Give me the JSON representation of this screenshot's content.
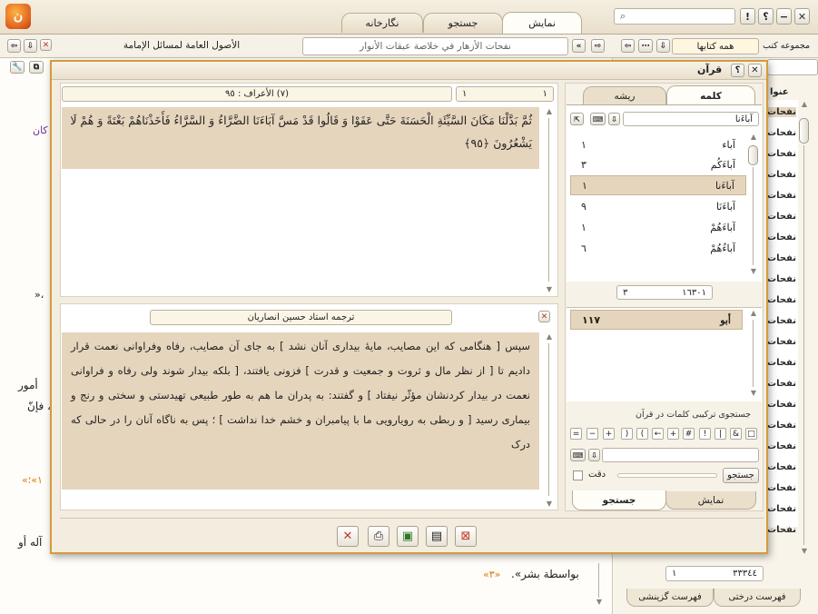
{
  "app": {
    "logo": "logo-icon",
    "top_tabs": [
      "نمایش",
      "جستجو",
      "نگارخانه"
    ],
    "search_value": "",
    "window_controls": [
      "close-icon",
      "minimize-icon",
      "help-icon",
      "info-icon"
    ]
  },
  "toolbar": {
    "book_title_left": "الأصول العامة لمسائل الإمامة",
    "book_title_mid": "نفحات الأزهار في خلاصة عبقات الأنوار",
    "collection_label": "مجموعه کتب",
    "collection_value": "همه کتابها"
  },
  "background": {
    "left_snippets": [
      "ذا کان",
      "»،",
      "أمور",
      "، فإنّ",
      "«١»؛",
      "آله أو"
    ],
    "bottom_text": "بواسطة بشر».",
    "bottom_ref": "«٣»",
    "ref_5": "«١»"
  },
  "right_panel": {
    "header_label": "عنوا",
    "items": [
      "نفحات",
      "نفحات",
      "نفحات",
      "نفحات",
      "نفحات",
      "نفحات",
      "نفحات",
      "نفحات",
      "نفحات",
      "نفحات",
      "نفحات",
      "نفحات",
      "نفحات",
      "نفحات",
      "نفحات",
      "نفحات",
      "نفحات",
      "نفحات",
      "نفحات",
      "نفحات",
      "نفحات",
      "نفحات",
      "نفحات"
    ],
    "page_total": "٣٣٣٤٤",
    "page_current": "١",
    "tabs": [
      "فهرست درختی",
      "فهرست گزینشی"
    ]
  },
  "dialog": {
    "title": "قرآن",
    "surah_field": "(٧) الأعراف : ٩٥",
    "page_a": "١",
    "page_b": "١",
    "verse": "ثُمَّ بَدَّلْنَا مَكَانَ السَّيِّئَةِ الْحَسَنَةَ حَتَّى عَفَوْا وَ قَالُوا قَدْ مَسَّ آبَاءَنَا الضَّرَّاءُ وَ السَّرَّاءُ فَأَخَذْنَاهُمْ بَغْتَةً وَ هُمْ لَا يَشْعُرُونَ ﴿٩٥﴾",
    "translator": "ترجمه استاد حسین انصاریان",
    "translation": "سپس [ هنگامی که این مصایب، مایهٔ بیداری آنان نشد ] به جای آن مصایب، رفاه وفراوانی نعمت قرار دادیم تا [ از نظر مال و ثروت و جمعیت و قدرت ] فزونی یافتند، [ بلکه بیدار شوند ولی رفاه و فراوانی نعمت در بیدار کردنشان مؤثّر نیفتاد ] و گفتند: به پدران ما هم به طور طبیعی تهیدستی و سختی و رنج و بیماری رسید [ و ربطی به رویارویی ما با پیامبران و خشم خدا نداشت ] ؛ پس به ناگاه آنان را در حالی که درک",
    "tabs_top": [
      "کلمه",
      "ریشه"
    ],
    "word_input": "آباءَنا",
    "words": [
      {
        "w": "آباء",
        "n": "١"
      },
      {
        "w": "آباءَكُم",
        "n": "٣"
      },
      {
        "w": "آباءَنا",
        "n": "١"
      },
      {
        "w": "آباءَنَا",
        "n": "٩"
      },
      {
        "w": "آباءَهُمْ",
        "n": "١"
      },
      {
        "w": "آباءُهُمْ",
        "n": "٦"
      }
    ],
    "count_total": "١٦٣٠١",
    "count_current": "٣",
    "root_item": {
      "w": "أبو",
      "n": "١١٧"
    },
    "compound_label": "جستجوی ترکیبی کلمات در قرآن",
    "operators": [
      "□",
      "&",
      "|",
      "!",
      "#",
      "+",
      "←",
      "(",
      ")",
      "+",
      "−",
      "="
    ],
    "search_btn": "جستجو",
    "exact_label": "دقت",
    "tabs_bottom": [
      "نمایش",
      "جستجو"
    ]
  }
}
